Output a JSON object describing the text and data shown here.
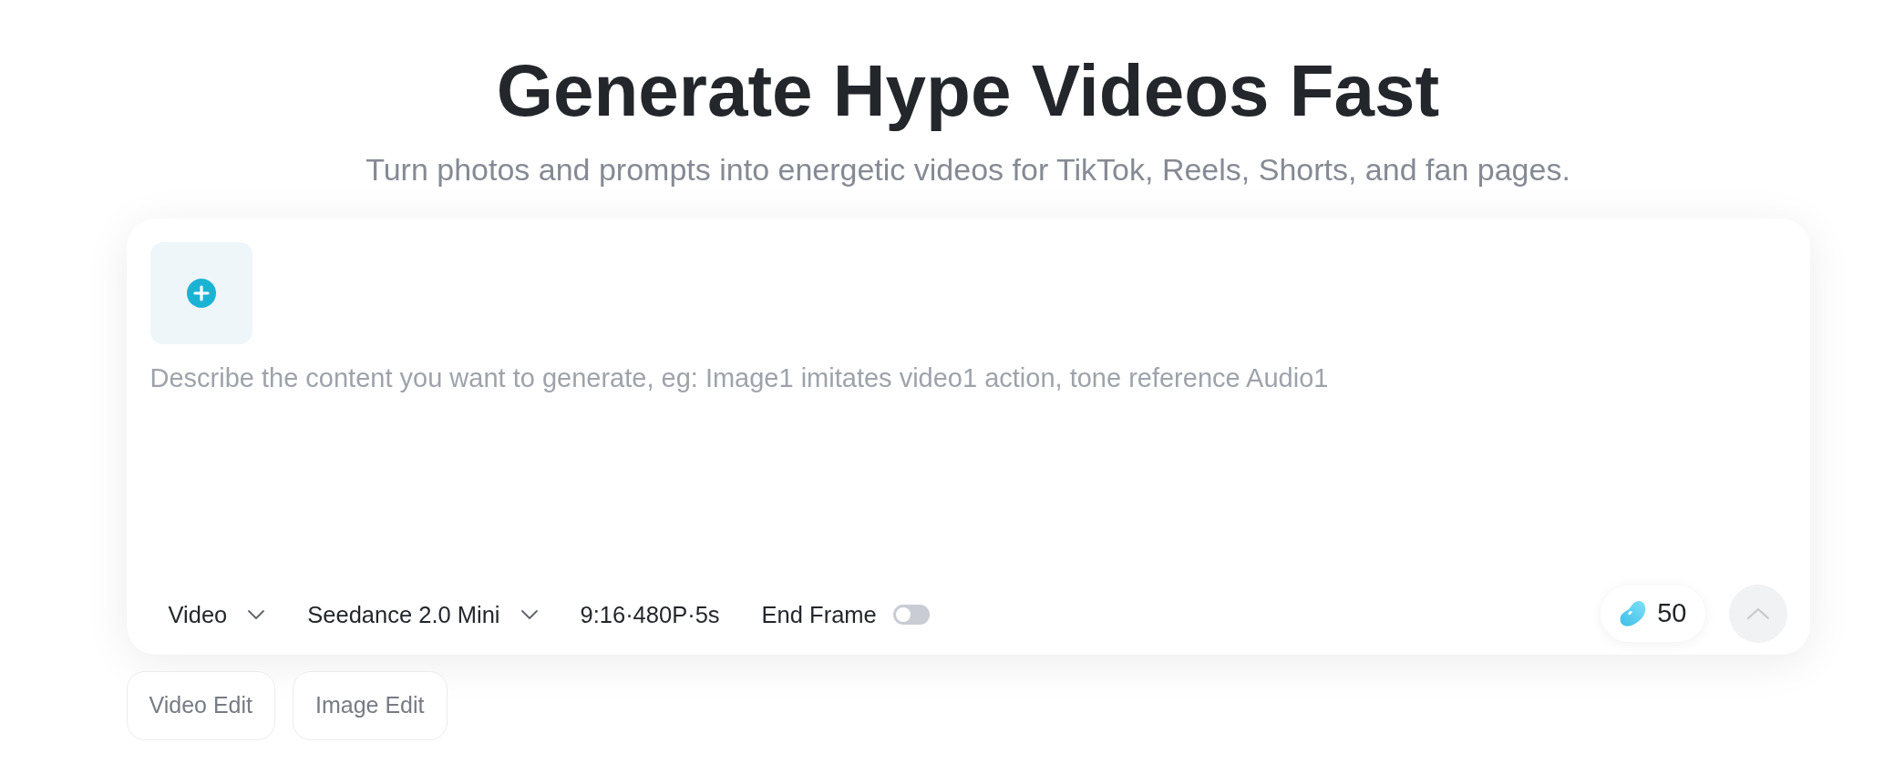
{
  "header": {
    "title": "Generate Hype Videos Fast",
    "subtitle": "Turn photos and prompts into energetic videos for TikTok, Reels, Shorts, and fan pages."
  },
  "composer": {
    "prompt": {
      "placeholder": "Describe the content you want to generate, eg: Image1 imitates video1 action, tone reference Audio1"
    },
    "options": [
      {
        "kind": "dropdown",
        "label": "Video"
      },
      {
        "kind": "dropdown",
        "label": "Seedance 2.0 Mini"
      },
      {
        "kind": "text",
        "label": "9:16·480P·5s"
      },
      {
        "kind": "toggle",
        "label": "End Frame",
        "on": false
      }
    ],
    "credits": "50",
    "send": {
      "disabled": true
    }
  },
  "quick_actions": [
    {
      "label": "Video Edit"
    },
    {
      "label": "Image Edit"
    }
  ]
}
